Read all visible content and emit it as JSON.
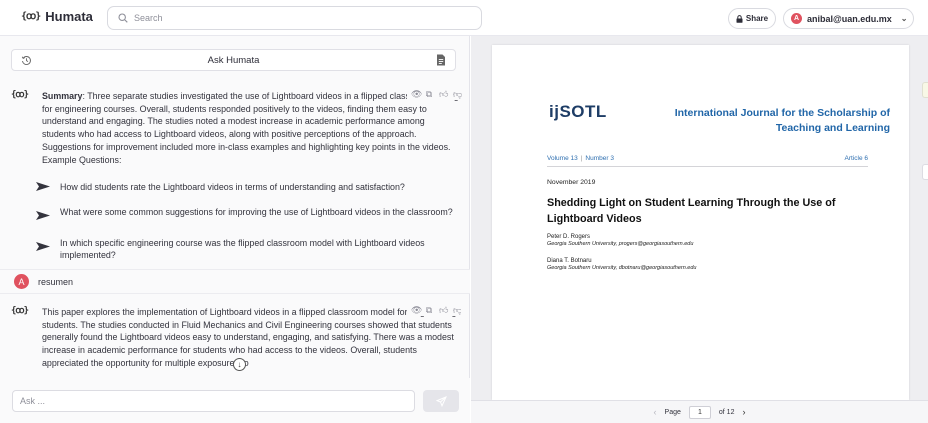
{
  "app": {
    "logo_mark": "{ꝏ}",
    "name": "Humata"
  },
  "search": {
    "placeholder": "Search"
  },
  "header": {
    "share_label": "Share",
    "account_initial": "A",
    "account_email": "anibal@uan.edu.mx"
  },
  "chat": {
    "title": "Ask Humata",
    "summary": {
      "label": "Summary",
      "text": ": Three separate studies investigated the use of Lightboard videos in a flipped classroom setting for engineering courses. Overall, students responded positively to the videos, finding them easy to understand and engaging. The studies noted a modest increase in academic performance among students who had access to Lightboard videos, along with positive perceptions of the approach. Suggestions for improvement included more in-class examples and highlighting key points in the videos.",
      "example_label": "Example Questions:"
    },
    "questions": [
      "How did students rate the Lightboard videos in terms of understanding and satisfaction?",
      "What were some common suggestions for improving the use of Lightboard videos in the classroom?",
      "In which specific engineering course was the flipped classroom model with Lightboard videos implemented?"
    ],
    "user_message": {
      "initial": "A",
      "text": "resumen"
    },
    "reply": "This paper explores the implementation of Lightboard videos in a flipped classroom model for engineering students. The studies conducted in Fluid Mechanics and Civil Engineering courses showed that students generally found the Lightboard videos easy to understand, engaging, and satisfying. There was a modest increase in academic performance for students who had access to the videos. Overall, students appreciated the opportunity for multiple exposures to",
    "input_placeholder": "Ask ..."
  },
  "document": {
    "logo": "ijSOTL",
    "journal_title": "International Journal for the Scholarship of Teaching and Learning",
    "volume": "Volume 13",
    "number": "Number 3",
    "article": "Article 6",
    "date": "November 2019",
    "title": "Shedding Light on Student Learning Through the Use of Lightboard Videos",
    "authors": [
      {
        "name": "Peter D. Rogers",
        "affiliation": "Georgia Southern University, progers@georgiasouthern.edu"
      },
      {
        "name": "Diana T. Botnaru",
        "affiliation": "Georgia Southern University, dbotnaru@georgiasouthern.edu"
      }
    ]
  },
  "pager": {
    "label": "Page",
    "current": "1",
    "total": "of 12"
  },
  "colors": {
    "accent_red": "#e0525f",
    "journal_blue": "#2166a8"
  }
}
